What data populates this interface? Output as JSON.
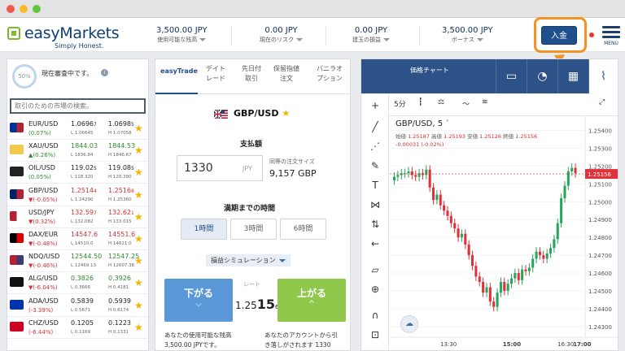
{
  "window": {
    "dots": [
      "#ee5a52",
      "#f5bd2b",
      "#5fc83f"
    ]
  },
  "brand": {
    "name": "easyMarkets",
    "tagline": "Simply Honest."
  },
  "header": {
    "stats": [
      {
        "value": "3,500.00 JPY",
        "label": "使用可能な残高"
      },
      {
        "value": "0.00 JPY",
        "label": "現在のリスク"
      },
      {
        "value": "0.00 JPY",
        "label": "建玉の損益"
      },
      {
        "value": "3,500.00 JPY",
        "label": "ボーナス"
      }
    ],
    "deposit_label": "入金",
    "menu_label": "MENU"
  },
  "account": {
    "review_pct": "50%",
    "review_text": "現在審査中です。",
    "info_icon": "i"
  },
  "search": {
    "placeholder": "取引のための市場の検索。"
  },
  "markets": [
    {
      "name": "EUR/USD",
      "chg": "(0.07%)",
      "dir": "up",
      "bid": "1.0696",
      "bid_s": "7",
      "ask": "1.0698",
      "ask_s": "5",
      "low": "L 1.06645",
      "high": "H 1.07058",
      "flag": [
        "#003399",
        "#b22234"
      ]
    },
    {
      "name": "XAU/USD",
      "chg": "▲(0.26%)",
      "dir": "up",
      "bid": "1844.03",
      "bid_s": "",
      "ask": "1844.53",
      "ask_s": "",
      "low": "L 1836.84",
      "high": "H 1846.67",
      "flag": [
        "#f2c94c",
        "#f2c94c"
      ]
    },
    {
      "name": "OIL/USD",
      "chg": "(0.05%)",
      "dir": "up",
      "bid": "119.02",
      "bid_s": "5",
      "ask": "119.08",
      "ask_s": "5",
      "low": "L 118.320",
      "high": "H 120.390",
      "flag": [
        "#222222",
        "#222222"
      ]
    },
    {
      "name": "GBP/USD",
      "chg": "▼(-0.05%)",
      "dir": "dn",
      "bid": "1.2514",
      "bid_s": "4",
      "ask": "1.2516",
      "ask_s": "8",
      "low": "L 1.24290",
      "high": "H 1.25360",
      "flag": [
        "#012169",
        "#b22234"
      ]
    },
    {
      "name": "USD/JPY",
      "chg": "▼(0.32%)",
      "dir": "dn",
      "bid": "132.59",
      "bid_s": "7",
      "ask": "132.62",
      "ask_s": "1",
      "low": "L 132.082",
      "high": "H 133.015",
      "flag": [
        "#b22234",
        "#ffffff"
      ]
    },
    {
      "name": "DAX/EUR",
      "chg": "▼(-0.48%)",
      "dir": "dn",
      "bid": "14547.6",
      "bid_s": "",
      "ask": "14551.6",
      "ask_s": "",
      "low": "L 14510.0",
      "high": "H 14621.0",
      "flag": [
        "#000000",
        "#dd0000"
      ]
    },
    {
      "name": "NDQ/USD",
      "chg": "▼(-0.46%)",
      "dir": "dn",
      "bid": "12544.50",
      "bid_s": "",
      "ask": "12547.25",
      "ask_s": "",
      "low": "L 12469.13",
      "high": "H 12607.38",
      "flag": [
        "#b22234",
        "#3c3b6e"
      ]
    },
    {
      "name": "ALG/USD",
      "chg": "▼(-6.04%)",
      "dir": "dn",
      "bid": "0.3826",
      "bid_s": "",
      "ask": "0.3926",
      "ask_s": "",
      "low": "L 0.3666",
      "high": "H 0.4181",
      "flag": [
        "#111111",
        "#111111"
      ]
    },
    {
      "name": "ADA/USD",
      "chg": "(-3.39%)",
      "dir": "dn",
      "bid": "0.5839",
      "bid_s": "",
      "ask": "0.5939",
      "ask_s": "",
      "low": "L 0.5671",
      "high": "H 0.6174",
      "flag": [
        "#0033ad",
        "#0033ad"
      ]
    },
    {
      "name": "CHZ/USD",
      "chg": "(-6.44%)",
      "dir": "dn",
      "bid": "0.1205",
      "bid_s": "",
      "ask": "0.1223",
      "ask_s": "",
      "low": "L 0.1169",
      "high": "H 0.1331",
      "flag": [
        "#cd0124",
        "#cd0124"
      ]
    }
  ],
  "trade": {
    "tabs": [
      "easyTrade",
      "デイトレード",
      "先日付取引",
      "保留指値注文",
      "バニラオプション"
    ],
    "pair": "GBP/USD",
    "amount_label": "支払額",
    "amount_value": "1330",
    "amount_currency": "JPY",
    "size_label": "同等の注文サイズ",
    "size_value": "9,157 GBP",
    "expiry_label": "満期までの時間",
    "expiries": [
      "1時間",
      "3時間",
      "6時間"
    ],
    "selected_expiry": 0,
    "simulation_label": "損益シミュレーション",
    "sell_label": "下がる",
    "buy_label": "上がる",
    "rate_label": "レート",
    "rate_main": "1.25",
    "rate_big": "15",
    "rate_small": "6",
    "note_left": [
      "あなたの使用可能な残高",
      "3,500.00 JPYです。"
    ],
    "note_right": [
      "あなたのアカウントから引",
      "き落しがされます 1330"
    ]
  },
  "chart_panel": {
    "title": "価格チャート",
    "timeframe": "5分",
    "symbol_line": "GBP/USD, 5",
    "ohlc_labels": [
      "始値",
      "高値",
      "安値",
      "終値"
    ],
    "ohlc_values": [
      "1.25187",
      "1.25193",
      "1.25126",
      "1.25156"
    ],
    "change": "-0.00031 (-0.02%)"
  },
  "chart_data": {
    "type": "candlestick",
    "title": "GBP/USD, 5",
    "ylim": [
      1.2424,
      1.2548
    ],
    "y_ticks": [
      "1.25400",
      "1.25300",
      "1.25200",
      "1.25100",
      "1.25000",
      "1.24900",
      "1.24800",
      "1.24700",
      "1.24600",
      "1.24500",
      "1.24400",
      "1.24300"
    ],
    "x_ticks": [
      "13:30",
      "15:00",
      "16:30",
      "17:00"
    ],
    "last_price": "1.25156",
    "close": [
      1.2514,
      1.2515,
      1.2516,
      1.2516,
      1.2517,
      1.2515,
      1.2514,
      1.2516,
      1.2515,
      1.2518,
      1.2508,
      1.2501,
      1.2504,
      1.2498,
      1.2495,
      1.2492,
      1.2488,
      1.2485,
      1.248,
      1.2482,
      1.2476,
      1.247,
      1.2464,
      1.2458,
      1.2455,
      1.2449,
      1.2452,
      1.2444,
      1.2441,
      1.2449,
      1.2455,
      1.245,
      1.2454,
      1.2457,
      1.246,
      1.2456,
      1.2462,
      1.2461,
      1.2463,
      1.2468,
      1.2472,
      1.247,
      1.2468,
      1.2471,
      1.2474,
      1.2479,
      1.2488,
      1.2502,
      1.2509,
      1.2517,
      1.2519,
      1.2516
    ]
  }
}
